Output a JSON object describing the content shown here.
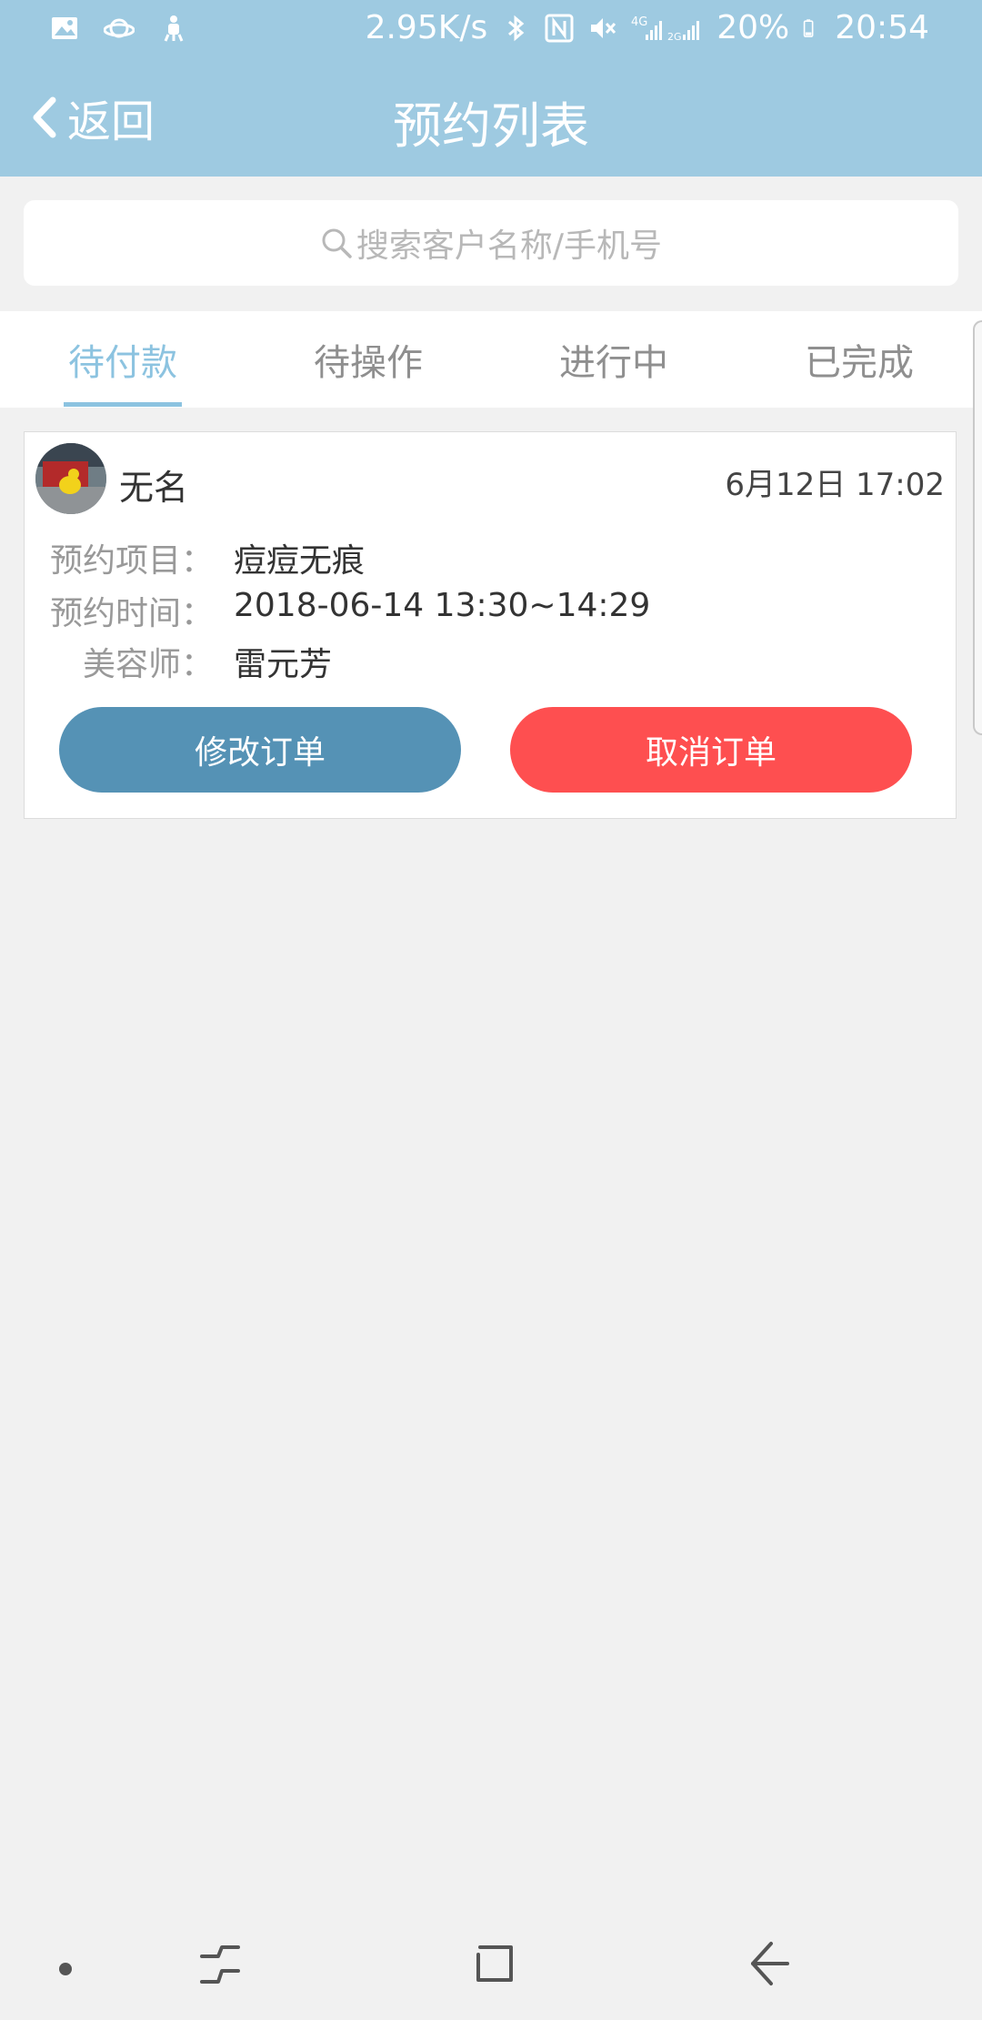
{
  "status_bar": {
    "network_speed": "2.95K/s",
    "network_4g": "4G",
    "network_2g": "2G",
    "battery": "20%",
    "time": "20:54",
    "icons": [
      "gallery-icon",
      "planet-icon",
      "usb-debug-icon",
      "bluetooth-icon",
      "nfc-icon",
      "mute-icon",
      "signal-icon",
      "battery-icon"
    ]
  },
  "header": {
    "back_label": "返回",
    "title": "预约列表",
    "color": "#9ecae1"
  },
  "search": {
    "placeholder": "搜索客户名称/手机号"
  },
  "tabs": [
    {
      "label": "待付款",
      "active": true
    },
    {
      "label": "待操作",
      "active": false
    },
    {
      "label": "进行中",
      "active": false
    },
    {
      "label": "已完成",
      "active": false
    }
  ],
  "orders": [
    {
      "customer_name": "无名",
      "created_time": "6月12日 17:02",
      "item_label": "预约项目：",
      "item_value": "痘痘无痕",
      "time_label": "预约时间：",
      "time_value": "2018-06-14 13:30~14:29",
      "beautician_label": "美容师：",
      "beautician_value": "雷元芳",
      "modify_label": "修改订单",
      "cancel_label": "取消订单"
    }
  ],
  "colors": {
    "accent": "#8cc3e0",
    "modify_button": "#5592b5",
    "cancel_button": "#fe4f50"
  }
}
